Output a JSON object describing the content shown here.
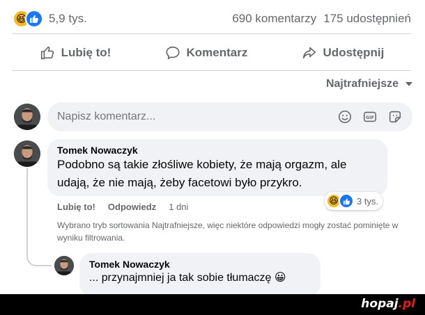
{
  "post_stats": {
    "reactions_count": "5,9 tys.",
    "comments_count": "690 komentarzy",
    "shares_count": "175 udostępnień"
  },
  "actions": {
    "like_label": "Lubię to!",
    "comment_label": "Komentarz",
    "share_label": "Udostępnij"
  },
  "sort": {
    "label": "Najtrafniejsze"
  },
  "composer": {
    "placeholder": "Napisz komentarz..."
  },
  "comment": {
    "author": "Tomek Nowaczyk",
    "text": "Podobno są takie złośliwe kobiety, że mają orgazm, ale udają, że nie mają, żeby facetowi było przykro.",
    "like_label": "Lubię to!",
    "reply_label": "Odpowiedz",
    "time": "1 dni",
    "reactions_count": "3 tys."
  },
  "filter_note": "Wybrano tryb sortowania Najtrafniejsze, więc niektóre odpowiedzi mogły zostać pominięte w wyniku filtrowania.",
  "reply": {
    "author": "Tomek Nowaczyk",
    "text": "... przynajmniej ja tak sobie tłumaczę",
    "emoji": "😀"
  },
  "watermark": {
    "brand": "hopaj",
    "tld": ".pl"
  },
  "colors": {
    "facebook_blue": "#1877f2",
    "haha_yellow": "#f7b928",
    "muted_text": "#65676b",
    "bubble_bg": "#f0f2f5"
  },
  "icons": [
    "haha-reaction-icon",
    "like-reaction-icon",
    "thumbs-up-icon",
    "speech-bubble-icon",
    "share-arrow-icon",
    "smiley-icon",
    "gif-icon",
    "sticker-icon"
  ]
}
